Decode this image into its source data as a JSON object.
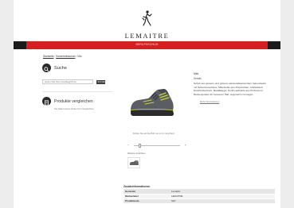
{
  "brand": {
    "name": "LEMAITRE"
  },
  "topbar": {
    "label": "BERUFSSCHUH"
  },
  "breadcrumb": {
    "link1": "Startseite",
    "link2": "Sicherheitsschuh",
    "current": "Milo"
  },
  "sidebar": {
    "search": {
      "title": "Suche",
      "placeholder": "Geben Sie Ihren Suchbegriff ein",
      "button": "SUCHE"
    },
    "compare": {
      "title": "Produkte vergleichen",
      "text": "Sie haben keine Artikel zum Vergleichen"
    }
  },
  "product": {
    "brand": "Milo",
    "label": "Details",
    "description": "Schuh aus grauem und grünem wasserabweisendem Veloursleder mit Schnürverschluss, Mittelsohle aus Polyurethan, Antistatisch, Durchtrittsschutz, Metallkappe, Profil-Laufsohle aus PU/Gummi, Rückenpolster für besseren Halt, angenehm zu tragen.",
    "more": "Mehr Informationen",
    "image_caption": "Klicken Sie auf das Bild, um es zu vergrößern",
    "more_views": "Weitere Ansichten",
    "colors": {
      "upper": "#5a5d61",
      "accent": "#c8d23a",
      "sole": "#2b2b2b"
    }
  },
  "info": {
    "title": "Zusatzinformationen",
    "rows": [
      {
        "key": "Hersteller",
        "value": "Lemaitre"
      },
      {
        "key": "Markenlabel",
        "value": "LEMAITRE"
      },
      {
        "key": "Produktcode",
        "value": "S1P"
      }
    ]
  }
}
